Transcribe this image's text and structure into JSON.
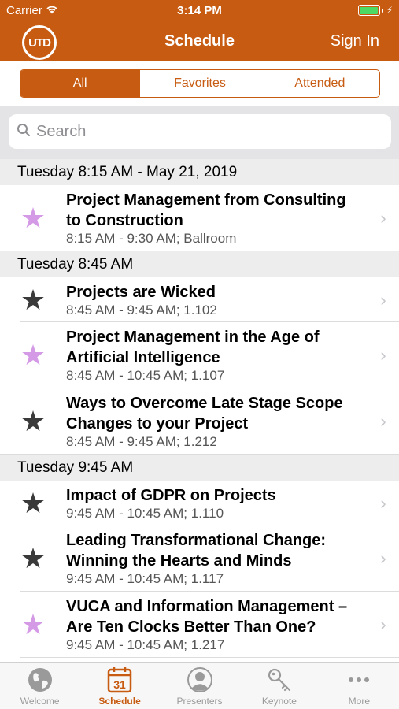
{
  "status_bar": {
    "carrier": "Carrier",
    "time": "3:14 PM"
  },
  "nav": {
    "logo_text": "UTD",
    "title": "Schedule",
    "sign_in": "Sign In"
  },
  "segments": {
    "all": "All",
    "favorites": "Favorites",
    "attended": "Attended",
    "selected": "All"
  },
  "search": {
    "placeholder": "Search"
  },
  "sections": [
    {
      "header": "Tuesday 8:15 AM - May 21, 2019",
      "items": [
        {
          "title_line1": "Project Management from Consulting",
          "title_line2": "to Construction",
          "subtitle": "8:15 AM - 9:30 AM; Ballroom",
          "favorite": true
        }
      ]
    },
    {
      "header": "Tuesday 8:45 AM",
      "items": [
        {
          "title_line1": "Projects are Wicked",
          "subtitle": "8:45 AM - 9:45 AM; 1.102",
          "favorite": false
        },
        {
          "title_line1": "Project Management in the Age of",
          "title_line2": "Artificial Intelligence",
          "subtitle": "8:45 AM - 10:45 AM; 1.107",
          "favorite": true
        },
        {
          "title_line1": "Ways to Overcome Late Stage Scope",
          "title_line2": "Changes to your Project",
          "subtitle": "8:45 AM - 9:45 AM; 1.212",
          "favorite": false
        }
      ]
    },
    {
      "header": "Tuesday 9:45 AM",
      "items": [
        {
          "title_line1": "Impact of GDPR on Projects",
          "subtitle": "9:45 AM - 10:45 AM; 1.110",
          "favorite": false
        },
        {
          "title_line1": "Leading Transformational Change:",
          "title_line2": "Winning the Hearts and Minds",
          "subtitle": "9:45 AM - 10:45 AM; 1.117",
          "favorite": false
        },
        {
          "title_line1": "VUCA and Information Management –",
          "title_line2": "Are Ten Clocks Better Than One?",
          "subtitle": "9:45 AM - 10:45 AM; 1.217",
          "favorite": true
        }
      ]
    }
  ],
  "tabs": [
    {
      "label": "Welcome",
      "icon": "globe-icon",
      "active": false
    },
    {
      "label": "Schedule",
      "icon": "calendar-icon",
      "calendar_day": "31",
      "active": true
    },
    {
      "label": "Presenters",
      "icon": "person-icon",
      "active": false
    },
    {
      "label": "Keynote",
      "icon": "key-icon",
      "active": false
    },
    {
      "label": "More",
      "icon": "more-icon",
      "active": false
    }
  ],
  "colors": {
    "brand": "#c75b12",
    "favorite_star": "#d59ae6",
    "regular_star": "#3a3a3a",
    "battery": "#4cd964"
  }
}
